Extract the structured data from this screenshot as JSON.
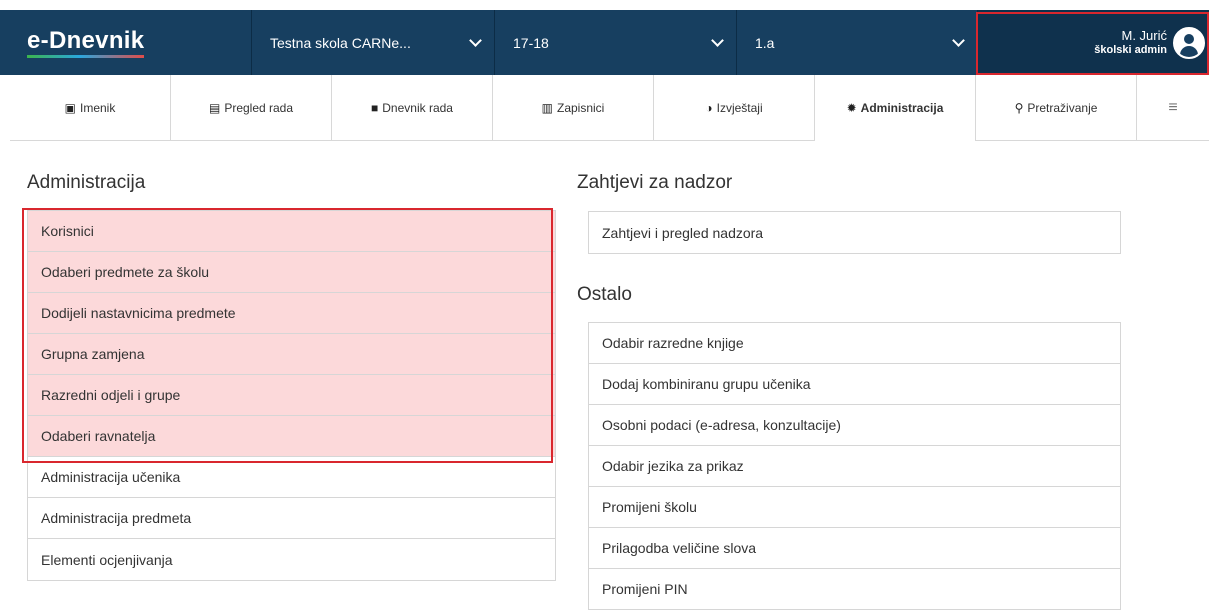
{
  "app": {
    "logo": "e-Dnevnik",
    "school_select": "Testna skola CARNe...",
    "year_select": "17-18",
    "class_select": "1.a",
    "user_name": "M. Jurić",
    "user_role": "školski admin",
    "highlight_color": "#d9272e",
    "header_color": "#173f60"
  },
  "nav": {
    "items": [
      {
        "label": "Imenik",
        "icon": "address-book-icon"
      },
      {
        "label": "Pregled rada",
        "icon": "clipboard-icon"
      },
      {
        "label": "Dnevnik rada",
        "icon": "book-icon"
      },
      {
        "label": "Zapisnici",
        "icon": "archive-icon"
      },
      {
        "label": "Izvještaji",
        "icon": "pie-chart-icon"
      },
      {
        "label": "Administracija",
        "icon": "cog-icon",
        "active": true
      },
      {
        "label": "Pretraživanje",
        "icon": "search-icon"
      }
    ],
    "menu_icon": "hamburger-menu-icon"
  },
  "administracija": {
    "title": "Administracija",
    "items": [
      "Korisnici",
      "Odaberi predmete za školu",
      "Dodijeli nastavnicima predmete",
      "Grupna zamjena",
      "Razredni odjeli i grupe",
      "Odaberi ravnatelja",
      "Administracija učenika",
      "Administracija predmeta",
      "Elementi ocjenjivanja"
    ]
  },
  "nadzor": {
    "title": "Zahtjevi za nadzor",
    "items": [
      "Zahtjevi i pregled nadzora"
    ]
  },
  "ostalo": {
    "title": "Ostalo",
    "items": [
      "Odabir razredne knjige",
      "Dodaj kombiniranu grupu učenika",
      "Osobni podaci (e-adresa, konzultacije)",
      "Odabir jezika za prikaz",
      "Promijeni školu",
      "Prilagodba veličine slova",
      "Promijeni PIN"
    ]
  }
}
